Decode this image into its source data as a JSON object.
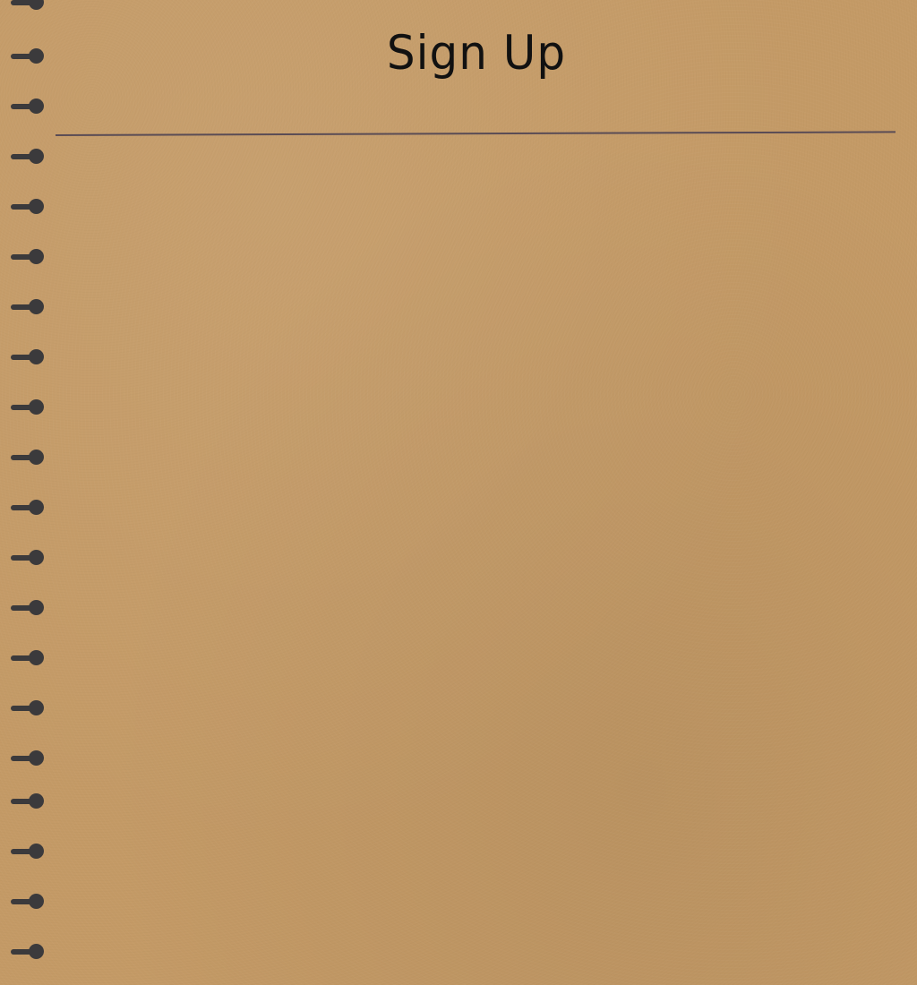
{
  "title": "Sign Up",
  "colors": {
    "paper": "#c49a66",
    "ring": "#3b3a3c",
    "divider": "#5a4c55",
    "text": "#111111"
  },
  "binding_ring_count": 20
}
